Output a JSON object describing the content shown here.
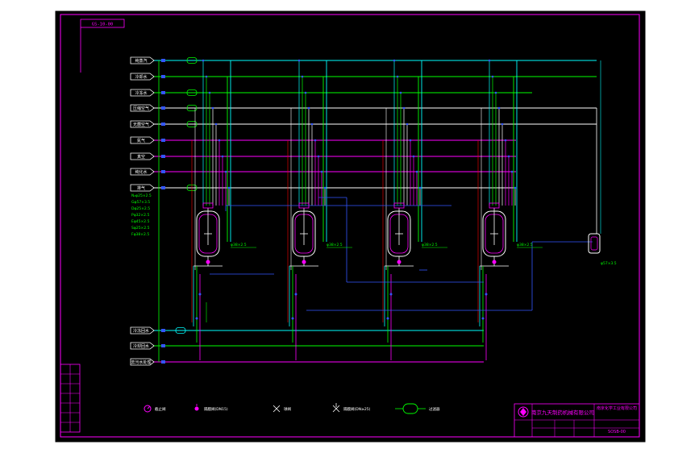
{
  "drawing": {
    "drawing_id": "GS-10-00",
    "company_name": "南京九天制药机械有限公司",
    "company_name_2": "南京化学工业有限公司",
    "drawing_number": "SOSB-00"
  },
  "inlets_top": [
    "纯蒸汽",
    "冷却水",
    "冷冻水",
    "压缩空气",
    "无菌空气",
    "氮气",
    "真空",
    "纯化水",
    "排气"
  ],
  "inlets_bottom": [
    "冷冻回水",
    "冷却回水",
    "去污水处理"
  ],
  "spec_notes": [
    "N₂φ25×2.5",
    "Gφ57×3.5",
    "Dφ25×2.5",
    "Pφ32×2.5",
    "Eφ45×2.5",
    "Sφ25×2.5",
    "Fφ38×2.5"
  ],
  "legend": [
    {
      "symbol": "circle-valve",
      "label": "截止阀"
    },
    {
      "symbol": "diaphragm-valve",
      "label": "隔膜阀(DN15)"
    },
    {
      "symbol": "gate-valve",
      "label": "球阀"
    },
    {
      "symbol": "check-valve",
      "label": "隔膜阀(DN≥25)"
    },
    {
      "symbol": "filter",
      "label": "过滤器"
    }
  ],
  "vessel_pipe_labels": [
    "φ38×2.5",
    "φ38×2.5",
    "φ38×2.5",
    "φ38×2.5"
  ],
  "filter_label": "φ57×3.5",
  "colors": {
    "background": "#000000",
    "frame": "#ffffff",
    "magenta": "#ff00ff",
    "cyan": "#00ffff",
    "green": "#00ff00",
    "red": "#ff0000",
    "blue": "#3355ff",
    "white": "#ffffff"
  }
}
